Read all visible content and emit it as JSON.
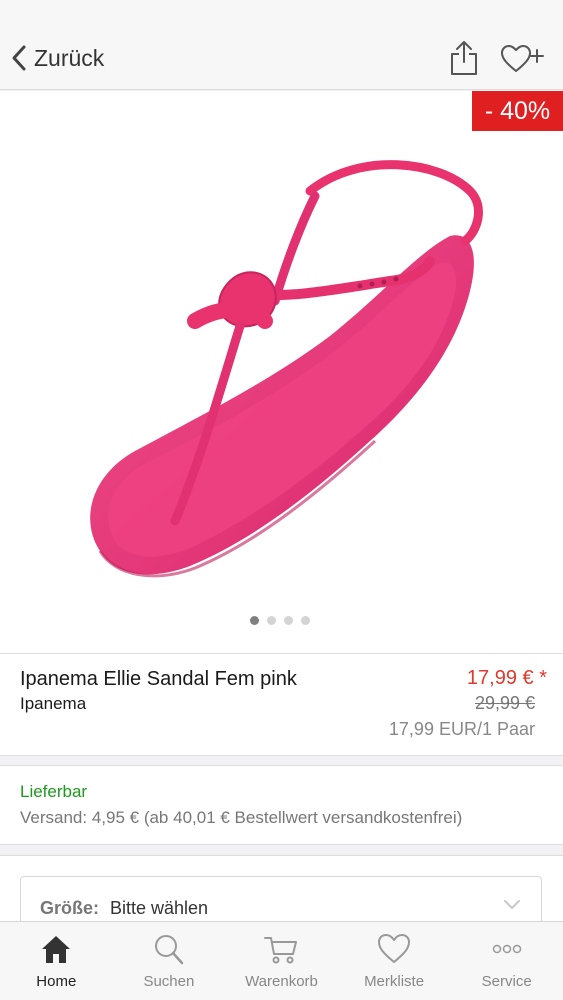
{
  "nav": {
    "back_label": "Zurück",
    "share_icon": "share-icon",
    "wishlist_icon": "heart-plus-icon"
  },
  "product": {
    "discount_badge": "- 40%",
    "name": "Ipanema Ellie Sandal Fem pink",
    "brand": "Ipanema",
    "price_current": "17,99 € *",
    "price_old": "29,99 €",
    "unit_price": "17,99 EUR/1 Paar",
    "image_count": 4,
    "image_active_index": 0
  },
  "delivery": {
    "availability": "Lieferbar",
    "shipping": "Versand: 4,95 € (ab 40,01 € Bestellwert versandkostenfrei)"
  },
  "size": {
    "label": "Größe:",
    "value": "Bitte wählen"
  },
  "tabbar": {
    "items": [
      {
        "label": "Home",
        "icon": "home-icon",
        "active": true
      },
      {
        "label": "Suchen",
        "icon": "search-icon",
        "active": false
      },
      {
        "label": "Warenkorb",
        "icon": "cart-icon",
        "active": false
      },
      {
        "label": "Merkliste",
        "icon": "heart-icon",
        "active": false
      },
      {
        "label": "Service",
        "icon": "more-icon",
        "active": false
      }
    ]
  },
  "colors": {
    "badge_red": "#e02020",
    "price_red": "#e0392e",
    "available_green": "#1d9a1d",
    "product_pink": "#e8336f"
  }
}
